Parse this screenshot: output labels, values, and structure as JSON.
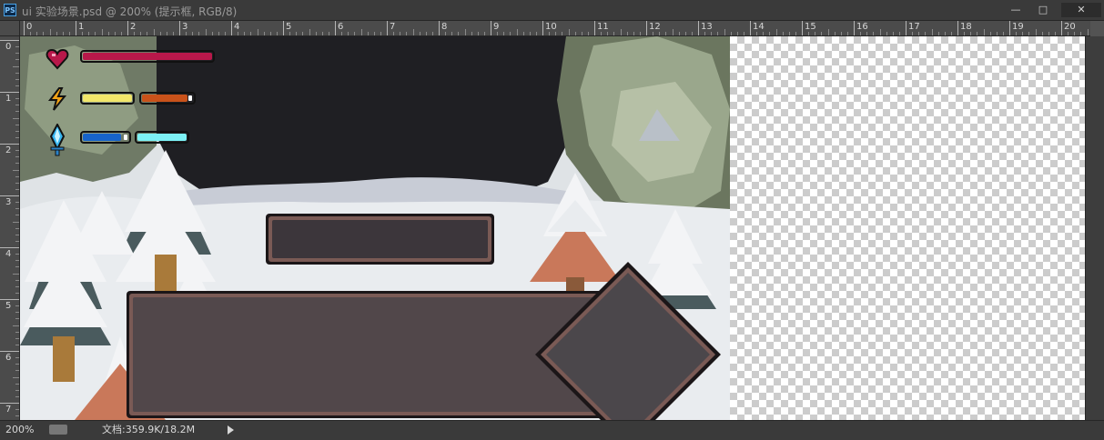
{
  "window": {
    "app_icon": "PS",
    "title": "ui 实验场景.psd @ 200% (提示框, RGB/8)",
    "controls": {
      "minimize": "—",
      "maximize": "□",
      "close": "✕"
    }
  },
  "rulers": {
    "top_labels": [
      "0",
      "1",
      "2",
      "3",
      "4",
      "5",
      "6",
      "7",
      "8",
      "9",
      "10",
      "11",
      "12",
      "13",
      "14",
      "15",
      "16",
      "17",
      "18",
      "19",
      "20"
    ],
    "left_labels": [
      "0",
      "1",
      "2",
      "3",
      "4",
      "5",
      "6",
      "7"
    ]
  },
  "status": {
    "zoom": "200%",
    "doc_info": "文档:359.9K/18.2M"
  },
  "hud": {
    "health": {
      "icon": "heart-icon",
      "fill_fraction": 1.0,
      "color": "#b8184a"
    },
    "energy": {
      "icon": "lightning-icon",
      "bars": [
        {
          "fill_fraction": 1.0,
          "color": "#f2e76a"
        },
        {
          "fill_fraction": 0.9,
          "color": "#c9521a"
        }
      ]
    },
    "mana": {
      "icon": "crystal-sword-icon",
      "bars": [
        {
          "fill_fraction": 0.85,
          "color": "#1763c9"
        },
        {
          "fill_fraction": 1.0,
          "color": "#7cf0f4"
        }
      ]
    }
  },
  "colors": {
    "panel_fill": "#3c363b",
    "panel_border": "#7a5a55",
    "snow": "#e9ecef",
    "cave": "#1f1f23",
    "rock": "#8f9c82",
    "tree_snow": "#f3f4f6",
    "tree_dark": "#4a5b5e",
    "tree_autumn": "#c9785a"
  }
}
